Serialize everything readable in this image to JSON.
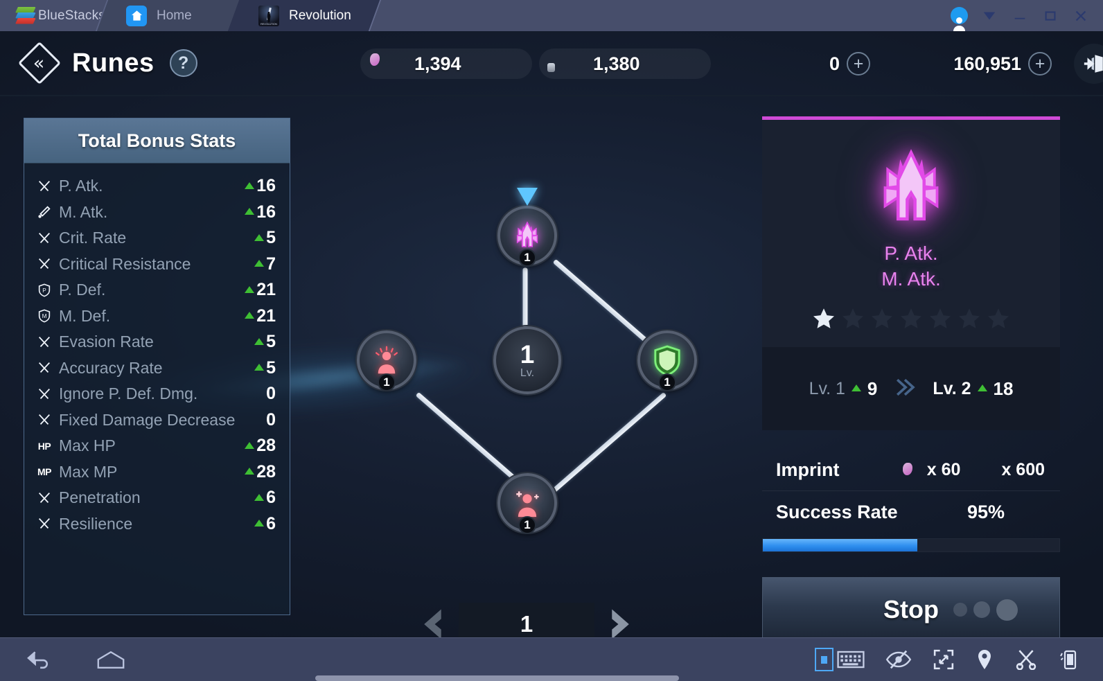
{
  "titlebar": {
    "brand": "BlueStacks",
    "tabs": [
      {
        "label": "Home",
        "icon": "home-icon",
        "active": false
      },
      {
        "label": "Revolution",
        "icon": "app-icon",
        "active": true
      }
    ],
    "window_controls": [
      "account-icon",
      "chevron-down-icon",
      "minimize-icon",
      "maximize-icon",
      "close-icon"
    ]
  },
  "header": {
    "back_icon": "«",
    "title": "Runes",
    "help_label": "?",
    "currencies": [
      {
        "icon": "rune-ore-icon",
        "value": "1,394",
        "has_plus": false
      },
      {
        "icon": "ruby-icon",
        "value": "1,380",
        "has_plus": false
      },
      {
        "icon": "sapphire-icon",
        "value": "0",
        "has_plus": true
      },
      {
        "icon": "gold-coin-icon",
        "value": "160,951",
        "has_plus": true
      }
    ],
    "exit_icon": "exit-door-icon"
  },
  "stats_panel": {
    "title": "Total Bonus Stats",
    "rows": [
      {
        "icon": "swords-icon",
        "name": "P. Atk.",
        "value": "16",
        "up": true
      },
      {
        "icon": "wand-icon",
        "name": "M. Atk.",
        "value": "16",
        "up": true
      },
      {
        "icon": "swords-icon",
        "name": "Crit. Rate",
        "value": "5",
        "up": true
      },
      {
        "icon": "swords-icon",
        "name": "Critical Resistance",
        "value": "7",
        "up": true
      },
      {
        "icon": "shield-p-icon",
        "name": "P. Def.",
        "value": "21",
        "up": true
      },
      {
        "icon": "shield-m-icon",
        "name": "M. Def.",
        "value": "21",
        "up": true
      },
      {
        "icon": "swords-icon",
        "name": "Evasion Rate",
        "value": "5",
        "up": true
      },
      {
        "icon": "swords-icon",
        "name": "Accuracy Rate",
        "value": "5",
        "up": true
      },
      {
        "icon": "swords-icon",
        "name": "Ignore P. Def. Dmg.",
        "value": "0",
        "up": false
      },
      {
        "icon": "swords-icon",
        "name": "Fixed Damage Decrease",
        "value": "0",
        "up": false
      },
      {
        "icon": "hp-text-icon",
        "name": "Max HP",
        "value": "28",
        "up": true
      },
      {
        "icon": "mp-text-icon",
        "name": "Max MP",
        "value": "28",
        "up": true
      },
      {
        "icon": "swords-icon",
        "name": "Penetration",
        "value": "6",
        "up": true
      },
      {
        "icon": "swords-icon",
        "name": "Resilience",
        "value": "6",
        "up": true
      }
    ]
  },
  "rune_graph": {
    "nodes": [
      {
        "id": "top",
        "icon": "rune-atk-icon",
        "level": "1",
        "selected": true
      },
      {
        "id": "left",
        "icon": "body-aura-icon",
        "level": "1",
        "selected": false
      },
      {
        "id": "center",
        "level": "1",
        "level_label": "Lv.",
        "icon": "rune-slot-center"
      },
      {
        "id": "right",
        "icon": "shield-green-icon",
        "level": "1",
        "selected": false
      },
      {
        "id": "bottom",
        "icon": "body-heal-icon",
        "level": "1",
        "selected": false
      }
    ],
    "pager": {
      "prev_icon": "chevron-left-icon",
      "page": "1",
      "next_icon": "chevron-right-icon"
    }
  },
  "detail_panel": {
    "accent_color": "#cf4ad6",
    "rune_icon": "rune-atk-icon",
    "stat_lines": [
      "P. Atk.",
      "M. Atk."
    ],
    "stars_total": 7,
    "stars_filled": 1,
    "level_current": {
      "label": "Lv. 1",
      "value": "9"
    },
    "level_next": {
      "label": "Lv. 2",
      "value": "18"
    },
    "imprint": {
      "label": "Imprint",
      "costs": [
        {
          "icon": "rune-ore-icon",
          "amount": "x 60"
        },
        {
          "icon": "gold-coin-icon",
          "amount": "x 600"
        }
      ]
    },
    "success_rate": {
      "label": "Success Rate",
      "value": "95%",
      "bar_percent": 52
    },
    "action_button": {
      "label": "Stop",
      "dots": 3
    }
  },
  "bottombar": {
    "left_items": [
      {
        "icon": "back-arrow-icon"
      },
      {
        "icon": "home-pentagon-icon"
      }
    ],
    "right_items": [
      {
        "icon": "keymap-toggle-icon"
      },
      {
        "icon": "keyboard-icon"
      },
      {
        "icon": "eye-off-icon"
      },
      {
        "icon": "fullscreen-icon"
      },
      {
        "icon": "location-pin-icon"
      },
      {
        "icon": "scissors-icon"
      },
      {
        "icon": "shake-phone-icon"
      }
    ]
  }
}
